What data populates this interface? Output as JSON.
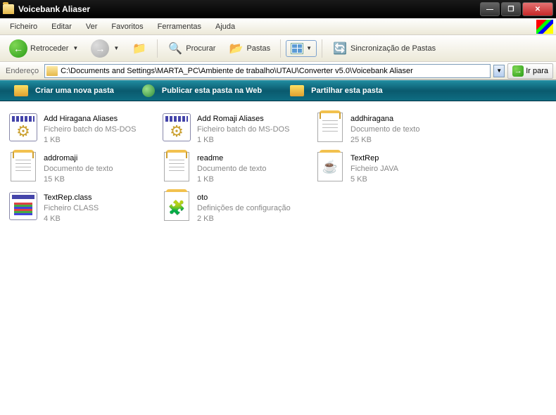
{
  "window": {
    "title": "Voicebank Aliaser"
  },
  "menu": {
    "file": "Ficheiro",
    "edit": "Editar",
    "view": "Ver",
    "favorites": "Favoritos",
    "tools": "Ferramentas",
    "help": "Ajuda"
  },
  "toolbar": {
    "back": "Retroceder",
    "search": "Procurar",
    "folders": "Pastas",
    "sync": "Sincronização de Pastas"
  },
  "address": {
    "label": "Endereço",
    "path": "C:\\Documents and Settings\\MARTA_PC\\Ambiente de trabalho\\UTAU\\Converter v5.0\\Voicebank Aliaser",
    "go": "Ir para"
  },
  "tasks": {
    "new_folder": "Criar uma nova pasta",
    "publish": "Publicar esta pasta na Web",
    "share": "Partilhar esta pasta"
  },
  "files": [
    {
      "name": "Add Hiragana Aliases",
      "type": "Ficheiro batch do MS-DOS",
      "size": "1 KB",
      "icon": "batch"
    },
    {
      "name": "Add Romaji Aliases",
      "type": "Ficheiro batch do MS-DOS",
      "size": "1 KB",
      "icon": "batch"
    },
    {
      "name": "addhiragana",
      "type": "Documento de texto",
      "size": "25 KB",
      "icon": "text"
    },
    {
      "name": "addromaji",
      "type": "Documento de texto",
      "size": "15 KB",
      "icon": "text"
    },
    {
      "name": "readme",
      "type": "Documento de texto",
      "size": "1 KB",
      "icon": "text"
    },
    {
      "name": "TextRep",
      "type": "Ficheiro JAVA",
      "size": "5 KB",
      "icon": "java"
    },
    {
      "name": "TextRep.class",
      "type": "Ficheiro CLASS",
      "size": "4 KB",
      "icon": "class"
    },
    {
      "name": "oto",
      "type": "Definições de configuração",
      "size": "2 KB",
      "icon": "config"
    }
  ]
}
